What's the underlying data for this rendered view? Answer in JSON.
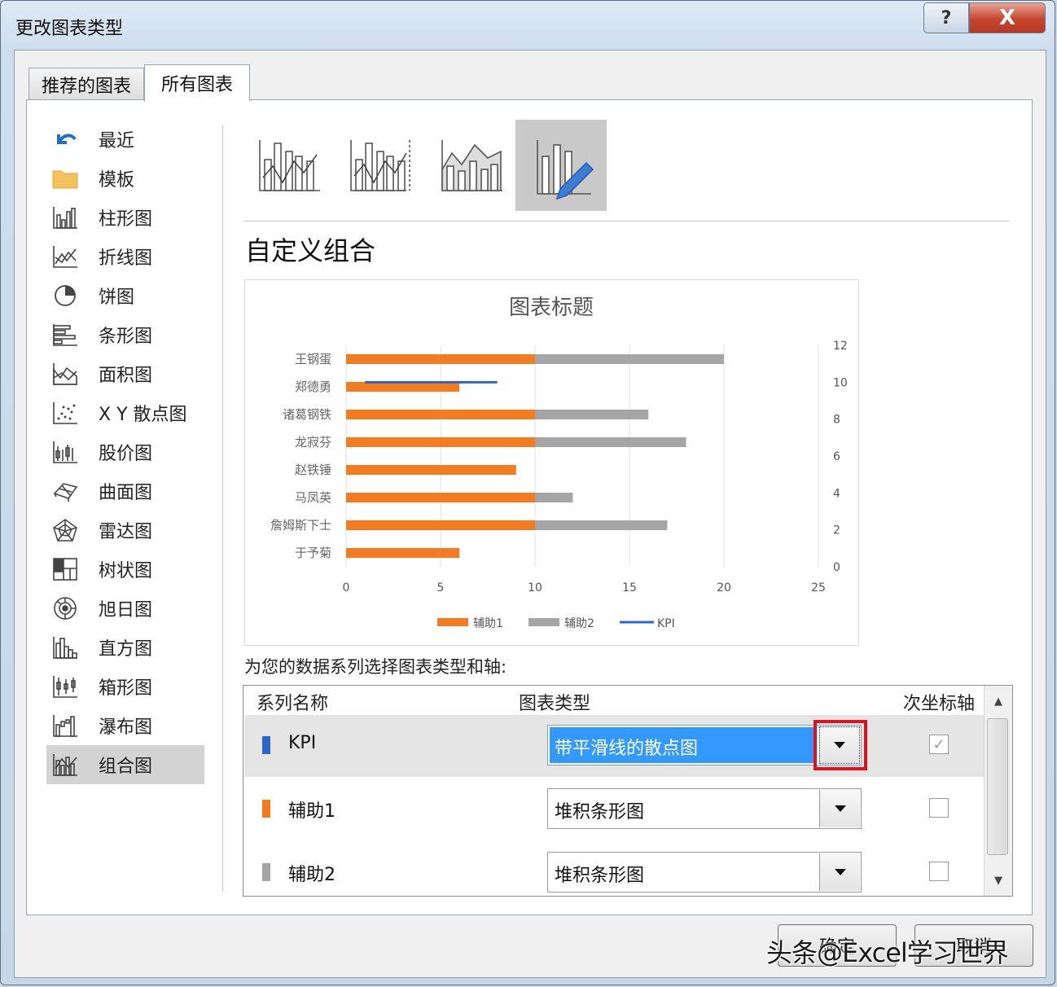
{
  "window": {
    "title": "更改图表类型",
    "help_label": "?",
    "close_label": "X"
  },
  "tabs": [
    {
      "label": "推荐的图表"
    },
    {
      "label": "所有图表"
    }
  ],
  "sidebar": {
    "items": [
      {
        "label": "最近",
        "icon": "undo-arrow-icon"
      },
      {
        "label": "模板",
        "icon": "folder-icon"
      },
      {
        "label": "柱形图",
        "icon": "column-chart-icon"
      },
      {
        "label": "折线图",
        "icon": "line-chart-icon"
      },
      {
        "label": "饼图",
        "icon": "pie-chart-icon"
      },
      {
        "label": "条形图",
        "icon": "bar-chart-icon"
      },
      {
        "label": "面积图",
        "icon": "area-chart-icon"
      },
      {
        "label": "X Y 散点图",
        "icon": "scatter-chart-icon"
      },
      {
        "label": "股价图",
        "icon": "stock-chart-icon"
      },
      {
        "label": "曲面图",
        "icon": "surface-chart-icon"
      },
      {
        "label": "雷达图",
        "icon": "radar-chart-icon"
      },
      {
        "label": "树状图",
        "icon": "treemap-icon"
      },
      {
        "label": "旭日图",
        "icon": "sunburst-icon"
      },
      {
        "label": "直方图",
        "icon": "histogram-icon"
      },
      {
        "label": "箱形图",
        "icon": "box-whisker-icon"
      },
      {
        "label": "瀑布图",
        "icon": "waterfall-icon"
      },
      {
        "label": "组合图",
        "icon": "combo-chart-icon"
      }
    ],
    "selected": "组合图"
  },
  "main": {
    "heading": "自定义组合",
    "instruction": "为您的数据系列选择图表类型和轴:"
  },
  "chart_data": {
    "type": "bar",
    "title": "图表标题",
    "categories": [
      "王钢蛋",
      "郑德勇",
      "诸葛钢铁",
      "龙寂芬",
      "赵铁锤",
      "马凤英",
      "詹姆斯下士",
      "于予菊"
    ],
    "series": [
      {
        "name": "辅助1",
        "color": "#f47b20",
        "stacked": true,
        "values": [
          10,
          6,
          10,
          10,
          9,
          10,
          10,
          6
        ]
      },
      {
        "name": "辅助2",
        "color": "#a5a5a5",
        "stacked": true,
        "values": [
          10,
          0,
          6,
          8,
          0,
          2,
          7,
          0
        ]
      },
      {
        "name": "KPI",
        "color": "#2e65c6",
        "type": "scatter-smooth-line",
        "points": [
          [
            1,
            10
          ],
          [
            8,
            10
          ]
        ]
      }
    ],
    "x_ticks": [
      "0",
      "5",
      "10",
      "15",
      "20",
      "25"
    ],
    "xlim": [
      0,
      25
    ],
    "y2_ticks": [
      "0",
      "2",
      "4",
      "6",
      "8",
      "10",
      "12"
    ],
    "y2lim": [
      0,
      12
    ],
    "legend": "bottom",
    "grid": "vertical"
  },
  "series_table": {
    "headers": {
      "name": "系列名称",
      "type": "图表类型",
      "secondary": "次坐标轴"
    },
    "rows": [
      {
        "name": "KPI",
        "color": "#2e65c6",
        "chart_type": "带平滑线的散点图",
        "secondary_axis": true
      },
      {
        "name": "辅助1",
        "color": "#f47b20",
        "chart_type": "堆积条形图",
        "secondary_axis": false
      },
      {
        "name": "辅助2",
        "color": "#a5a5a5",
        "chart_type": "堆积条形图",
        "secondary_axis": false
      }
    ]
  },
  "buttons": {
    "ok": "确定",
    "cancel": "取消"
  },
  "watermark": "头条@Excel学习世界"
}
